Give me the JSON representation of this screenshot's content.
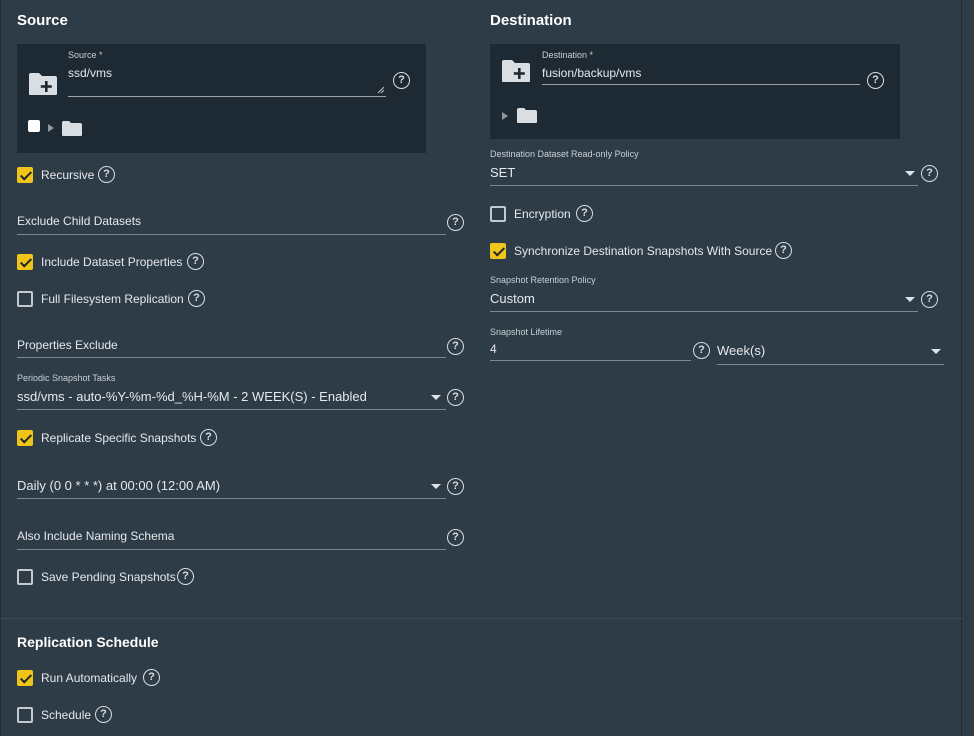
{
  "source": {
    "title": "Source",
    "source_field_label": "Source *",
    "source_value": "ssd/vms",
    "recursive_label": "Recursive",
    "exclude_child_label": "Exclude Child Datasets",
    "include_props_label": "Include Dataset Properties",
    "full_fs_label": "Full Filesystem Replication",
    "props_exclude_label": "Properties Exclude",
    "periodic_tasks_label": "Periodic Snapshot Tasks",
    "periodic_tasks_value": "ssd/vms - auto-%Y-%m-%d_%H-%M - 2 WEEK(S) - Enabled",
    "replicate_specific_label": "Replicate Specific Snapshots",
    "schedule_value": "Daily (0 0 * * *) at 00:00 (12:00 AM)",
    "naming_schema_label": "Also Include Naming Schema",
    "save_pending_label": "Save Pending Snapshots"
  },
  "destination": {
    "title": "Destination",
    "dest_field_label": "Destination *",
    "dest_value": "fusion/backup/vms",
    "readonly_policy_label": "Destination Dataset Read-only Policy",
    "readonly_policy_value": "SET",
    "encryption_label": "Encryption",
    "sync_label": "Synchronize Destination Snapshots With Source",
    "retention_label": "Snapshot Retention Policy",
    "retention_value": "Custom",
    "lifetime_label": "Snapshot Lifetime",
    "lifetime_value": "4",
    "lifetime_unit": "Week(s)"
  },
  "schedule": {
    "title": "Replication Schedule",
    "run_auto_label": "Run Automatically",
    "schedule_label": "Schedule"
  },
  "checkbox_states": {
    "recursive": true,
    "include_props": true,
    "full_fs": false,
    "replicate_specific": true,
    "save_pending": false,
    "encryption": false,
    "sync": true,
    "run_auto": true,
    "schedule": false,
    "source_tree": false
  },
  "help_glyph": "?",
  "colors": {
    "accent": "#f0c419",
    "background": "#2e3c47",
    "panel": "#1e2a33"
  }
}
